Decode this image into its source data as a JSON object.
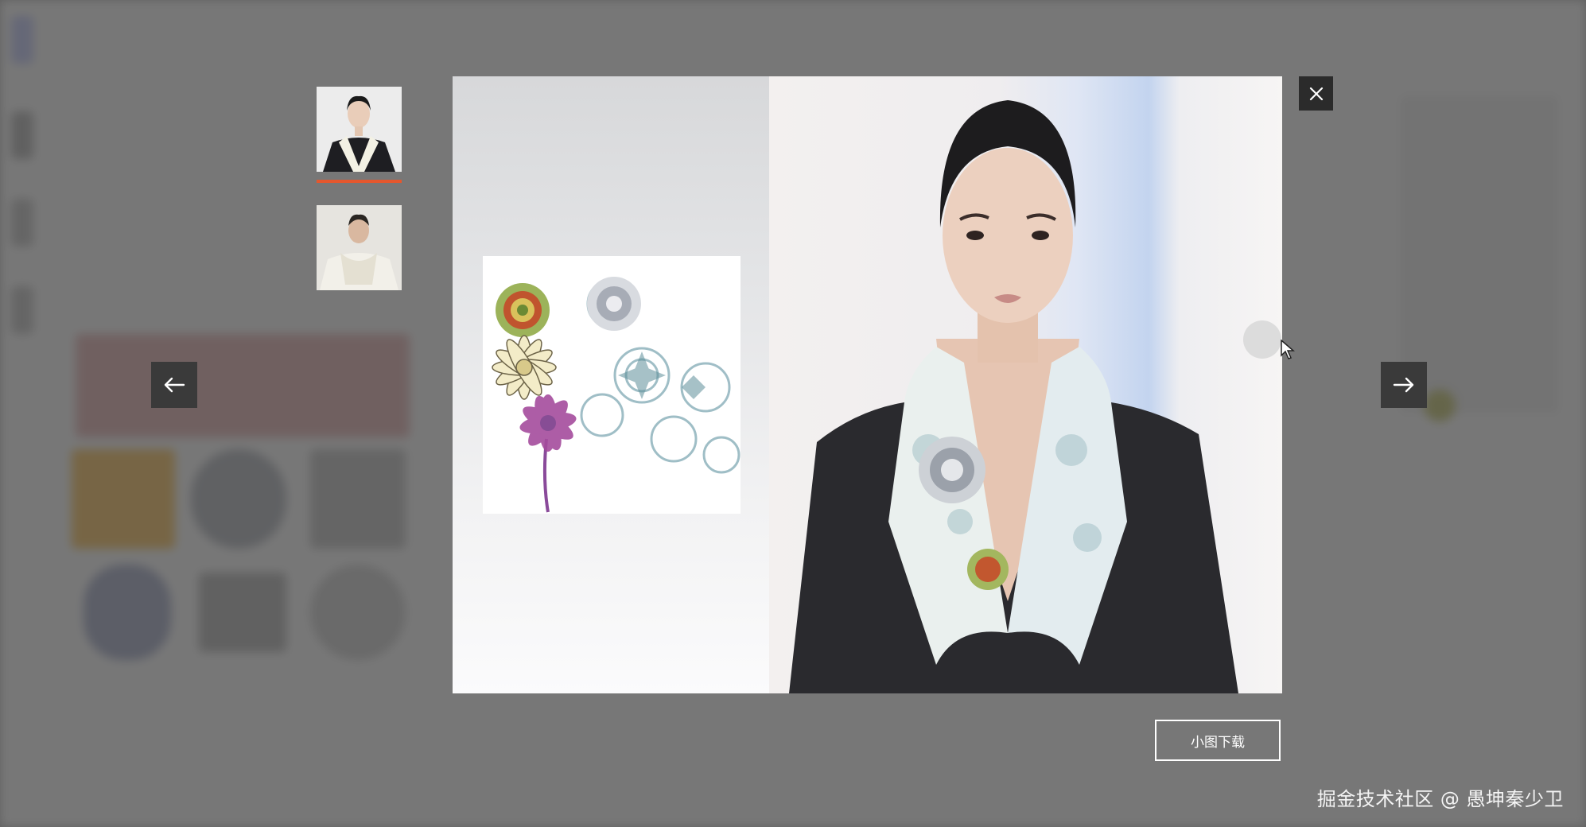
{
  "viewer": {
    "download_label": "小图下载",
    "close_icon": "close-icon",
    "prev_icon": "arrow-left-icon",
    "next_icon": "arrow-right-icon",
    "thumbnails": [
      {
        "name": "woman-scarf-thumbnail",
        "selected": true
      },
      {
        "name": "man-scarf-thumbnail",
        "selected": false
      }
    ],
    "accent_color": "#e4572e"
  },
  "watermark": "掘金技术社区 @ 愚坤秦少卫"
}
